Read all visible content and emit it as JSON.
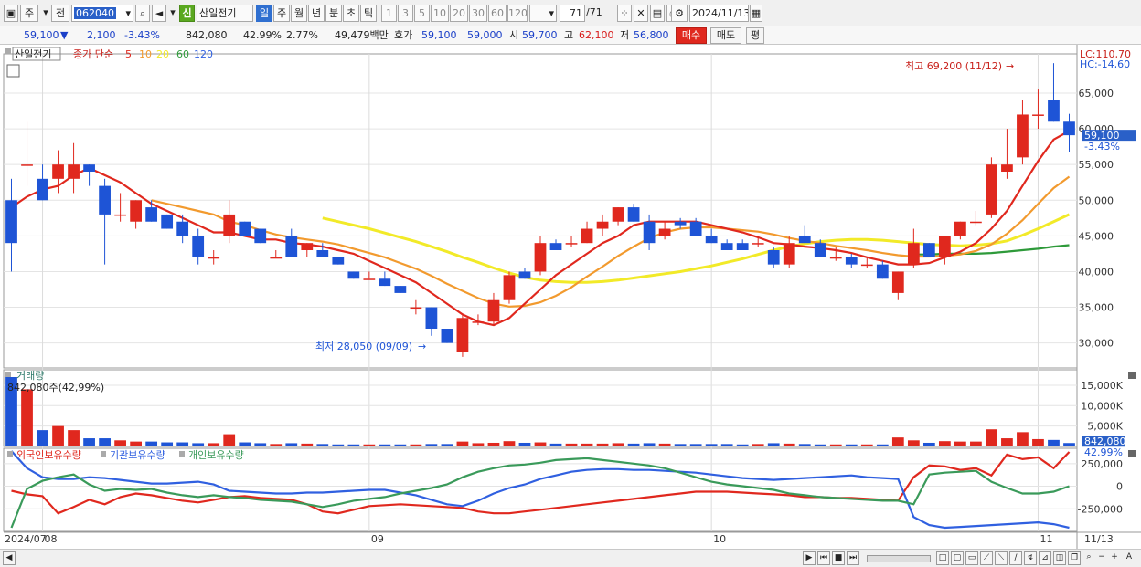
{
  "toolbar": {
    "period_labels": [
      "주",
      "전"
    ],
    "stock_code": "062040",
    "stock_badge": "신",
    "stock_name": "산일전기",
    "timeframes": [
      "일",
      "주",
      "월",
      "년",
      "분",
      "초",
      "틱"
    ],
    "active_timeframe": "일",
    "interval_buttons": [
      "1",
      "3",
      "5",
      "10",
      "20",
      "30",
      "60",
      "120"
    ],
    "page_counter": "71",
    "page_total": "/71",
    "date": "2024/11/13"
  },
  "quote": {
    "price": "59,100",
    "change_arrow": "▼",
    "change": "2,100",
    "change_pct": "-3.43%",
    "volume": "842,080",
    "volume_ratio": "42.99%",
    "turnover": "2.77%",
    "amount": "49,479백만",
    "ask_label": "호가",
    "ask1": "59,100",
    "ask2": "59,000",
    "open_label": "시",
    "open": "59,700",
    "high_label": "고",
    "high": "62,100",
    "low_label": "저",
    "low": "56,800",
    "buy_label": "매수",
    "sell_label": "매도",
    "eval_label": "평"
  },
  "legend": {
    "name": "산일전기",
    "type": "종가 단순",
    "ma_periods": [
      "5",
      "10",
      "20",
      "60",
      "120"
    ]
  },
  "annotations": {
    "high_label": "최고 69,200 (11/12)",
    "low_label": "최저 28,050 (09/09)",
    "lc": "LC:110,70",
    "hc": "HC:-14,60",
    "price_tag": "59,100",
    "price_tag_pct": "-3.43%",
    "volume_title": "거래량",
    "volume_desc": "842,080주(42,99%)",
    "volume_tag": "842,080",
    "volume_tag_pct": "42.99%",
    "holdings_legend": [
      "외국인보유수량",
      "기관보유수량",
      "개인보유수량"
    ]
  },
  "axes": {
    "price_ticks": [
      "65,000",
      "60,000",
      "55,000",
      "50,000",
      "45,000",
      "40,000",
      "35,000",
      "30,000"
    ],
    "volume_ticks": [
      "15,000K",
      "10,000K",
      "5,000K"
    ],
    "holdings_ticks": [
      "250,000",
      "0",
      "-250,000"
    ],
    "date_ticks": [
      "2024/07",
      "08",
      "09",
      "10",
      "11",
      "11/13"
    ]
  },
  "colors": {
    "up": "#e0281e",
    "down": "#1e54d6",
    "ma5": "#e0281e",
    "ma10": "#f29a2e",
    "ma20": "#f2ea28",
    "ma60": "#2e9a3a",
    "foreign": "#e0281e",
    "institution": "#3060e0",
    "individual": "#3a9a5a"
  },
  "chart_data": {
    "type": "candlestick",
    "ylim": [
      26500,
      70500
    ],
    "candles": [
      [
        50000,
        53000,
        40000,
        44000
      ],
      [
        55000,
        61000,
        52000,
        55000
      ],
      [
        53000,
        55000,
        50000,
        50000
      ],
      [
        53000,
        57000,
        51000,
        55000
      ],
      [
        53000,
        58000,
        51000,
        55000
      ],
      [
        55000,
        55000,
        52000,
        54000
      ],
      [
        52000,
        53000,
        41000,
        48000
      ],
      [
        48000,
        51000,
        47000,
        48000
      ],
      [
        47000,
        50000,
        46000,
        50000
      ],
      [
        49000,
        50000,
        47000,
        47000
      ],
      [
        48000,
        48000,
        46000,
        46000
      ],
      [
        47000,
        48000,
        44000,
        45000
      ],
      [
        45000,
        46000,
        41000,
        42000
      ],
      [
        42000,
        43000,
        41000,
        42000
      ],
      [
        45000,
        50000,
        44000,
        48000
      ],
      [
        47000,
        47000,
        45000,
        45000
      ],
      [
        46000,
        46000,
        44000,
        44000
      ],
      [
        42000,
        43000,
        42000,
        42000
      ],
      [
        45000,
        46000,
        42000,
        42000
      ],
      [
        43000,
        44000,
        42000,
        44000
      ],
      [
        43000,
        44000,
        42000,
        42000
      ],
      [
        42000,
        42000,
        41000,
        41000
      ],
      [
        40000,
        40000,
        39000,
        39000
      ],
      [
        39000,
        40000,
        39000,
        39000
      ],
      [
        39000,
        40000,
        38000,
        38000
      ],
      [
        38000,
        38000,
        37000,
        37000
      ],
      [
        35000,
        36000,
        34000,
        35000
      ],
      [
        35000,
        35000,
        31000,
        32000
      ],
      [
        32000,
        32000,
        30000,
        30000
      ],
      [
        28800,
        34000,
        28050,
        33500
      ],
      [
        33000,
        34000,
        32500,
        33000
      ],
      [
        33000,
        37000,
        32500,
        36000
      ],
      [
        36000,
        40000,
        35500,
        39500
      ],
      [
        40000,
        40500,
        39000,
        39000
      ],
      [
        40000,
        45000,
        39500,
        44000
      ],
      [
        44000,
        44500,
        43000,
        43000
      ],
      [
        44000,
        45000,
        43500,
        44000
      ],
      [
        44000,
        47000,
        44000,
        46000
      ],
      [
        46000,
        48000,
        45000,
        47000
      ],
      [
        47000,
        49000,
        46500,
        49000
      ],
      [
        49000,
        49500,
        47000,
        47000
      ],
      [
        47000,
        48000,
        43000,
        44000
      ],
      [
        45000,
        47000,
        44500,
        46000
      ],
      [
        47000,
        47500,
        46000,
        46500
      ],
      [
        47000,
        47500,
        45000,
        45000
      ],
      [
        45000,
        46000,
        44000,
        44000
      ],
      [
        44000,
        44500,
        43000,
        43000
      ],
      [
        44000,
        44500,
        43000,
        43000
      ],
      [
        44000,
        45000,
        43500,
        44000
      ],
      [
        43000,
        43500,
        40500,
        41000
      ],
      [
        41000,
        45000,
        40500,
        44000
      ],
      [
        45000,
        46500,
        44000,
        44000
      ],
      [
        44000,
        44500,
        42000,
        42000
      ],
      [
        42000,
        43500,
        41500,
        42000
      ],
      [
        42000,
        42500,
        40500,
        41000
      ],
      [
        41000,
        42000,
        40500,
        41000
      ],
      [
        41000,
        41500,
        39000,
        39000
      ],
      [
        37000,
        40000,
        36000,
        40000
      ],
      [
        41000,
        46000,
        40500,
        44000
      ],
      [
        44000,
        44000,
        42000,
        42000
      ],
      [
        42000,
        45000,
        41000,
        45000
      ],
      [
        45000,
        47000,
        44500,
        47000
      ],
      [
        47000,
        48500,
        46500,
        47000
      ],
      [
        48000,
        56000,
        47500,
        55000
      ],
      [
        54000,
        60000,
        53000,
        55000
      ],
      [
        56000,
        64000,
        55000,
        62000
      ],
      [
        62000,
        65500,
        60000,
        62000
      ],
      [
        64000,
        69200,
        61000,
        61000
      ],
      [
        61000,
        62100,
        56800,
        59100
      ]
    ],
    "ma5": [
      49000,
      50500,
      51500,
      52000,
      53500,
      54500,
      53500,
      52500,
      51000,
      49500,
      48500,
      47500,
      46500,
      45500,
      45500,
      45000,
      44500,
      44500,
      44000,
      43800,
      43500,
      43000,
      42500,
      41500,
      40500,
      39500,
      38500,
      37000,
      35500,
      34000,
      33000,
      32500,
      33500,
      35500,
      37500,
      39500,
      41000,
      42500,
      44000,
      45000,
      46500,
      47000,
      47000,
      47000,
      47000,
      46500,
      46000,
      45500,
      44800,
      44000,
      43800,
      43500,
      43300,
      43000,
      42600,
      42000,
      41500,
      41000,
      41000,
      41200,
      42000,
      42800,
      44000,
      46000,
      48500,
      52000,
      55500,
      58500,
      59700
    ],
    "ma10": [
      null,
      null,
      null,
      null,
      null,
      null,
      null,
      null,
      null,
      50000,
      49500,
      49000,
      48500,
      48000,
      47000,
      46500,
      45800,
      45200,
      44800,
      44500,
      44200,
      43800,
      43200,
      42600,
      42000,
      41200,
      40400,
      39400,
      38300,
      37300,
      36300,
      35500,
      35100,
      35200,
      35700,
      36600,
      37800,
      39300,
      40700,
      42200,
      43500,
      44700,
      45500,
      46000,
      46200,
      46200,
      46000,
      45800,
      45600,
      45200,
      44700,
      44300,
      44000,
      43600,
      43300,
      43000,
      42600,
      42300,
      42100,
      42100,
      42200,
      42400,
      42900,
      43800,
      45300,
      47200,
      49500,
      51700,
      53300
    ],
    "ma20": [
      null,
      null,
      null,
      null,
      null,
      null,
      null,
      null,
      null,
      null,
      null,
      null,
      null,
      null,
      null,
      null,
      null,
      null,
      null,
      null,
      47500,
      47000,
      46500,
      46000,
      45400,
      44800,
      44200,
      43500,
      42800,
      42000,
      41300,
      40500,
      39800,
      39200,
      38800,
      38600,
      38500,
      38500,
      38600,
      38800,
      39100,
      39400,
      39700,
      40000,
      40400,
      40800,
      41300,
      41800,
      42400,
      43000,
      43500,
      43900,
      44200,
      44400,
      44500,
      44500,
      44400,
      44200,
      44000,
      43800,
      43700,
      43600,
      43700,
      43900,
      44300,
      45100,
      46000,
      47000,
      48000
    ],
    "ma60": [
      null,
      null,
      null,
      null,
      null,
      null,
      null,
      null,
      null,
      null,
      null,
      null,
      null,
      null,
      null,
      null,
      null,
      null,
      null,
      null,
      null,
      null,
      null,
      null,
      null,
      null,
      null,
      null,
      null,
      null,
      null,
      null,
      null,
      null,
      null,
      null,
      null,
      null,
      null,
      null,
      null,
      null,
      null,
      null,
      null,
      null,
      null,
      null,
      null,
      null,
      null,
      null,
      null,
      null,
      null,
      null,
      null,
      null,
      42400,
      42400,
      42500,
      42500,
      42500,
      42600,
      42800,
      43000,
      43200,
      43500,
      43700
    ],
    "volume_max_k": 17000,
    "volume_k": [
      17000,
      14000,
      4000,
      5000,
      4000,
      2000,
      2000,
      1500,
      1200,
      1200,
      1000,
      1000,
      800,
      800,
      3000,
      1000,
      800,
      600,
      800,
      700,
      600,
      500,
      500,
      500,
      500,
      500,
      500,
      600,
      600,
      1200,
      800,
      900,
      1300,
      900,
      1000,
      700,
      700,
      700,
      700,
      800,
      700,
      800,
      700,
      600,
      600,
      600,
      600,
      500,
      600,
      800,
      700,
      600,
      500,
      500,
      500,
      500,
      500,
      2200,
      1500,
      900,
      1300,
      1200,
      1200,
      4200,
      2000,
      3500,
      1800,
      1600,
      842
    ],
    "foreign": [
      -50000,
      -90000,
      -110000,
      -300000,
      -230000,
      -150000,
      -200000,
      -120000,
      -80000,
      -100000,
      -130000,
      -160000,
      -180000,
      -150000,
      -120000,
      -110000,
      -130000,
      -140000,
      -150000,
      -200000,
      -280000,
      -300000,
      -260000,
      -220000,
      -210000,
      -200000,
      -210000,
      -220000,
      -230000,
      -240000,
      -280000,
      -300000,
      -300000,
      -280000,
      -260000,
      -240000,
      -220000,
      -200000,
      -180000,
      -160000,
      -140000,
      -120000,
      -100000,
      -80000,
      -60000,
      -60000,
      -60000,
      -70000,
      -80000,
      -90000,
      -100000,
      -120000,
      -120000,
      -130000,
      -130000,
      -140000,
      -150000,
      -160000,
      100000,
      230000,
      220000,
      180000,
      200000,
      120000,
      350000,
      300000,
      320000,
      200000,
      380000
    ],
    "institution": [
      390000,
      200000,
      100000,
      80000,
      80000,
      100000,
      90000,
      70000,
      50000,
      30000,
      30000,
      40000,
      50000,
      20000,
      -50000,
      -60000,
      -70000,
      -80000,
      -80000,
      -70000,
      -70000,
      -60000,
      -50000,
      -40000,
      -40000,
      -70000,
      -100000,
      -150000,
      -200000,
      -220000,
      -160000,
      -80000,
      -20000,
      20000,
      80000,
      120000,
      160000,
      180000,
      190000,
      190000,
      180000,
      180000,
      170000,
      160000,
      150000,
      130000,
      110000,
      90000,
      80000,
      70000,
      80000,
      90000,
      100000,
      110000,
      120000,
      100000,
      90000,
      80000,
      -340000,
      -430000,
      -460000,
      -450000,
      -440000,
      -430000,
      -420000,
      -410000,
      -400000,
      -420000,
      -460000
    ],
    "individual": [
      -460000,
      -30000,
      60000,
      100000,
      130000,
      20000,
      -50000,
      -30000,
      -40000,
      -30000,
      -70000,
      -100000,
      -120000,
      -100000,
      -120000,
      -130000,
      -150000,
      -160000,
      -170000,
      -200000,
      -230000,
      -200000,
      -160000,
      -140000,
      -120000,
      -80000,
      -50000,
      -20000,
      20000,
      100000,
      160000,
      200000,
      230000,
      240000,
      260000,
      290000,
      300000,
      310000,
      290000,
      270000,
      250000,
      230000,
      200000,
      150000,
      100000,
      50000,
      20000,
      0,
      -20000,
      -40000,
      -80000,
      -100000,
      -120000,
      -130000,
      -140000,
      -150000,
      -160000,
      -160000,
      -200000,
      130000,
      150000,
      160000,
      170000,
      50000,
      -20000,
      -80000,
      -80000,
      -60000,
      0
    ]
  }
}
